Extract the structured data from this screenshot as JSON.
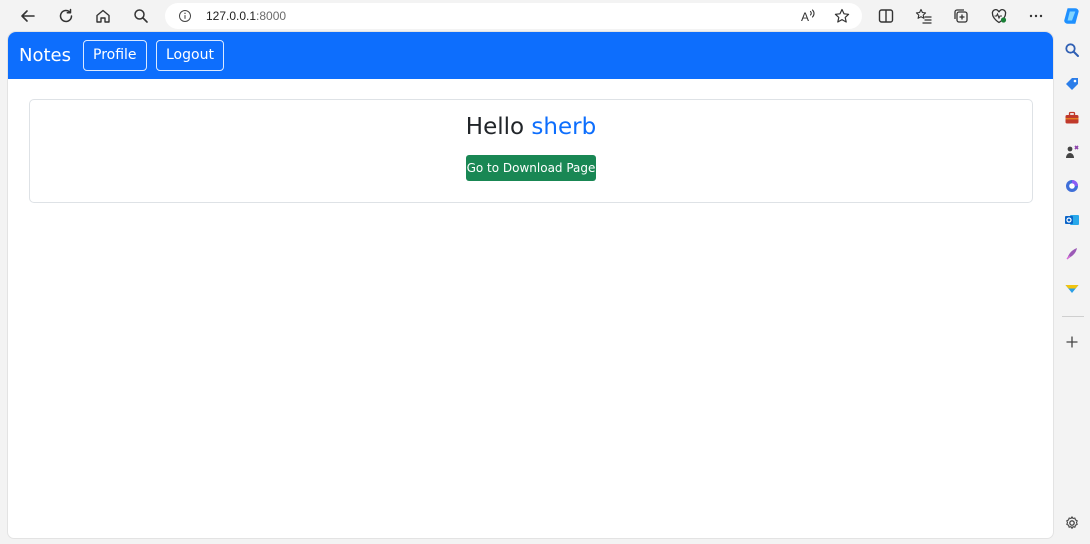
{
  "browser": {
    "address": {
      "host": "127.0.0.1",
      "port": ":8000"
    },
    "toolbar_icons": [
      "back-icon",
      "refresh-icon",
      "home-icon",
      "search-icon",
      "info-icon",
      "read-aloud-icon",
      "favorite-star-icon",
      "split-screen-icon",
      "favorites-icon",
      "collections-icon",
      "browser-essentials-icon",
      "more-icon"
    ],
    "sidebar_icons": [
      "copilot-icon",
      "search-icon",
      "shopping-tag-icon",
      "tools-icon",
      "games-icon",
      "microsoft365-icon",
      "outlook-icon",
      "designer-icon",
      "drop-icon",
      "add-icon",
      "settings-icon"
    ],
    "colors": {
      "chrome_bg": "#f3f3f3",
      "navbar": "#0d6efd",
      "username": "#0d6efd",
      "success_button": "#198754"
    }
  },
  "navbar": {
    "brand": "Notes",
    "profile_label": "Profile",
    "logout_label": "Logout"
  },
  "main": {
    "greeting_prefix": "Hello",
    "username": "sherb",
    "download_button_label": "Go to Download Page"
  }
}
